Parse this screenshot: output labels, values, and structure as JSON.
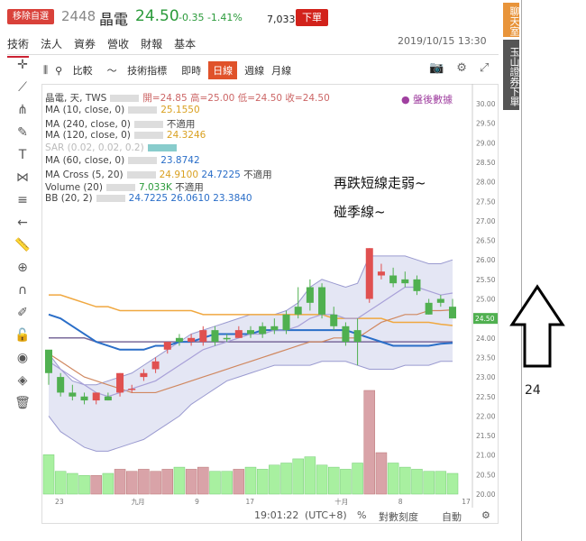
{
  "header": {
    "tag_button": "移除自選",
    "code": "2448",
    "name": "晶電",
    "price": "24.50",
    "change": "-0.35 -1.41%",
    "volume": "7,033.4張",
    "order_button": "下單",
    "datetime": "2019/10/15 13:30"
  },
  "tabs": [
    "技術",
    "法人",
    "資券",
    "營收",
    "財報",
    "基本"
  ],
  "sidebar": {
    "chat": "聊天室",
    "broker": "玉山證券下單"
  },
  "chart_toolbar": {
    "compare": "比較",
    "indicators": "技術指標",
    "realtime": "即時",
    "daily": "日線",
    "weekly": "週線",
    "monthly": "月線"
  },
  "info": {
    "line1": "晶電, 天, TWS",
    "ohlc": "開=24.85 高=25.00 低=24.50 收=24.50",
    "ma10": "MA (10, close, 0)",
    "ma10v": "25.1550",
    "ma240": "MA (240, close, 0)",
    "ma240v": "不適用",
    "ma120": "MA (120, close, 0)",
    "ma120v": "24.3246",
    "sar": "SAR (0.02, 0.02, 0.2)",
    "ma60": "MA (60, close, 0)",
    "ma60v": "23.8742",
    "macross": "MA Cross (5, 20)",
    "macv1": "24.9100",
    "macv2": "24.7225",
    "macv3": "不適用",
    "volume": "Volume (20)",
    "volv1": "7.033K",
    "volv2": "不適用",
    "bb": "BB (20, 2)",
    "bbv1": "24.7225",
    "bbv2": "26.0610",
    "bbv3": "23.3840"
  },
  "watermark": "盤後數據",
  "notes": {
    "line1": "再跌短線走弱~",
    "line2": "碰季線~"
  },
  "bottom": {
    "time": "19:01:22",
    "tz": "(UTC+8)",
    "pct": "%",
    "log": "對數刻度",
    "auto": "自動"
  },
  "arrow_label": "24",
  "chart_data": {
    "type": "candlestick",
    "y_ticks": [
      "30.00",
      "29.50",
      "29.00",
      "28.50",
      "28.00",
      "27.50",
      "27.00",
      "26.50",
      "26.00",
      "25.50",
      "25.00",
      "24.50",
      "24.00",
      "23.50",
      "23.00",
      "22.50",
      "22.00",
      "21.50",
      "21.00",
      "20.50",
      "20.00"
    ],
    "x_ticks": [
      "23",
      "九月",
      "9",
      "17",
      "十月",
      "8",
      "17"
    ],
    "last_price_label": "24.50",
    "candles": [
      {
        "o": 23.1,
        "h": 23.6,
        "l": 22.8,
        "c": 23.7,
        "up": false
      },
      {
        "o": 23.0,
        "h": 23.1,
        "l": 22.5,
        "c": 22.6,
        "up": false
      },
      {
        "o": 22.6,
        "h": 22.8,
        "l": 22.4,
        "c": 22.5,
        "up": false
      },
      {
        "o": 22.5,
        "h": 22.6,
        "l": 22.3,
        "c": 22.4,
        "up": false
      },
      {
        "o": 22.4,
        "h": 22.6,
        "l": 22.3,
        "c": 22.6,
        "up": true
      },
      {
        "o": 22.5,
        "h": 22.6,
        "l": 22.4,
        "c": 22.4,
        "up": false
      },
      {
        "o": 22.6,
        "h": 23.1,
        "l": 22.5,
        "c": 23.1,
        "up": true
      },
      {
        "o": 22.7,
        "h": 22.8,
        "l": 22.6,
        "c": 22.7,
        "up": true
      },
      {
        "o": 23.0,
        "h": 23.2,
        "l": 22.9,
        "c": 23.1,
        "up": true
      },
      {
        "o": 23.2,
        "h": 23.5,
        "l": 23.1,
        "c": 23.4,
        "up": true
      },
      {
        "o": 23.7,
        "h": 23.9,
        "l": 23.6,
        "c": 23.9,
        "up": true
      },
      {
        "o": 23.9,
        "h": 24.1,
        "l": 23.8,
        "c": 24.0,
        "up": false
      },
      {
        "o": 24.0,
        "h": 24.1,
        "l": 23.8,
        "c": 23.9,
        "up": true
      },
      {
        "o": 23.9,
        "h": 24.3,
        "l": 23.8,
        "c": 24.2,
        "up": true
      },
      {
        "o": 24.2,
        "h": 24.3,
        "l": 23.8,
        "c": 23.9,
        "up": false
      },
      {
        "o": 24.0,
        "h": 24.1,
        "l": 23.9,
        "c": 24.0,
        "up": false
      },
      {
        "o": 24.0,
        "h": 24.3,
        "l": 24.0,
        "c": 24.2,
        "up": true
      },
      {
        "o": 24.2,
        "h": 24.3,
        "l": 24.0,
        "c": 24.1,
        "up": false
      },
      {
        "o": 24.1,
        "h": 24.4,
        "l": 24.0,
        "c": 24.3,
        "up": false
      },
      {
        "o": 24.3,
        "h": 24.5,
        "l": 24.1,
        "c": 24.2,
        "up": false
      },
      {
        "o": 24.2,
        "h": 24.7,
        "l": 24.1,
        "c": 24.6,
        "up": false
      },
      {
        "o": 24.6,
        "h": 25.3,
        "l": 24.5,
        "c": 24.8,
        "up": false
      },
      {
        "o": 24.9,
        "h": 25.5,
        "l": 24.7,
        "c": 25.3,
        "up": false
      },
      {
        "o": 25.3,
        "h": 25.4,
        "l": 24.5,
        "c": 24.6,
        "up": false
      },
      {
        "o": 24.6,
        "h": 24.8,
        "l": 24.2,
        "c": 24.3,
        "up": false
      },
      {
        "o": 24.3,
        "h": 24.4,
        "l": 23.8,
        "c": 23.9,
        "up": false
      },
      {
        "o": 23.9,
        "h": 24.5,
        "l": 23.3,
        "c": 24.2,
        "up": false
      },
      {
        "o": 25.0,
        "h": 26.3,
        "l": 24.9,
        "c": 26.3,
        "up": true
      },
      {
        "o": 25.7,
        "h": 25.9,
        "l": 25.5,
        "c": 25.6,
        "up": true
      },
      {
        "o": 25.6,
        "h": 25.8,
        "l": 25.3,
        "c": 25.4,
        "up": false
      },
      {
        "o": 25.5,
        "h": 25.7,
        "l": 25.3,
        "c": 25.4,
        "up": false
      },
      {
        "o": 25.5,
        "h": 25.6,
        "l": 25.1,
        "c": 25.2,
        "up": false
      },
      {
        "o": 24.9,
        "h": 25.0,
        "l": 24.6,
        "c": 24.6,
        "up": false
      },
      {
        "o": 24.9,
        "h": 25.1,
        "l": 24.8,
        "c": 25.0,
        "up": false
      },
      {
        "o": 24.8,
        "h": 25.0,
        "l": 24.5,
        "c": 24.5,
        "up": false
      }
    ],
    "volumes": [
      38,
      22,
      20,
      18,
      18,
      20,
      24,
      22,
      24,
      22,
      24,
      26,
      24,
      26,
      22,
      22,
      24,
      26,
      24,
      28,
      30,
      34,
      36,
      28,
      26,
      24,
      30,
      100,
      40,
      30,
      26,
      24,
      22,
      22,
      20
    ],
    "bb_upper": [
      23.6,
      23.2,
      22.9,
      22.8,
      22.8,
      22.9,
      23.0,
      23.1,
      23.3,
      23.5,
      23.7,
      23.9,
      24.1,
      24.2,
      24.3,
      24.4,
      24.5,
      24.6,
      24.6,
      24.6,
      24.7,
      24.9,
      25.3,
      25.5,
      25.4,
      25.3,
      25.4,
      26.1,
      26.1,
      26.1,
      26.1,
      26.0,
      25.9,
      25.9,
      26.0
    ],
    "bb_lower": [
      22.0,
      21.6,
      21.4,
      21.2,
      21.1,
      21.1,
      21.2,
      21.3,
      21.4,
      21.6,
      21.8,
      22.0,
      22.3,
      22.5,
      22.7,
      22.9,
      23.0,
      23.1,
      23.2,
      23.3,
      23.3,
      23.3,
      23.3,
      23.4,
      23.4,
      23.4,
      23.3,
      23.2,
      23.2,
      23.2,
      23.3,
      23.3,
      23.3,
      23.4,
      23.4
    ],
    "ma10": [
      23.4,
      23.2,
      23.0,
      22.8,
      22.6,
      22.5,
      22.6,
      22.7,
      22.8,
      22.9,
      23.1,
      23.3,
      23.5,
      23.7,
      23.8,
      23.9,
      24.0,
      24.1,
      24.1,
      24.2,
      24.2,
      24.3,
      24.5,
      24.6,
      24.6,
      24.5,
      24.5,
      24.7,
      24.9,
      25.1,
      25.3,
      25.3,
      25.2,
      25.1,
      25.15
    ],
    "ma20": [
      23.6,
      23.4,
      23.2,
      23.0,
      22.9,
      22.8,
      22.7,
      22.6,
      22.6,
      22.6,
      22.7,
      22.8,
      22.9,
      23.0,
      23.1,
      23.2,
      23.3,
      23.4,
      23.5,
      23.6,
      23.7,
      23.8,
      23.9,
      23.9,
      24.0,
      24.0,
      24.0,
      24.2,
      24.4,
      24.5,
      24.6,
      24.6,
      24.7,
      24.7,
      24.72
    ],
    "ma60": [
      24.6,
      24.5,
      24.3,
      24.1,
      23.9,
      23.8,
      23.7,
      23.7,
      23.7,
      23.8,
      23.8,
      23.9,
      23.9,
      24.0,
      24.1,
      24.1,
      24.1,
      24.1,
      24.2,
      24.2,
      24.2,
      24.2,
      24.2,
      24.2,
      24.2,
      24.2,
      24.1,
      24.0,
      23.9,
      23.8,
      23.8,
      23.8,
      23.8,
      23.85,
      23.87
    ],
    "ma120": [
      25.1,
      25.1,
      25.0,
      24.9,
      24.8,
      24.8,
      24.7,
      24.7,
      24.7,
      24.7,
      24.7,
      24.7,
      24.7,
      24.6,
      24.6,
      24.6,
      24.6,
      24.6,
      24.6,
      24.6,
      24.6,
      24.6,
      24.6,
      24.6,
      24.5,
      24.5,
      24.5,
      24.5,
      24.5,
      24.4,
      24.4,
      24.4,
      24.4,
      24.35,
      24.32
    ],
    "ma240": [
      24.0,
      24.0,
      24.0,
      24.0,
      23.9,
      23.9,
      23.9,
      23.9,
      23.9,
      23.9,
      23.9,
      23.9,
      23.9,
      23.9,
      23.9,
      23.9,
      23.9,
      23.9,
      23.9,
      23.9,
      23.9,
      23.9,
      23.9,
      23.9,
      23.9,
      23.9,
      23.9,
      23.9,
      23.9,
      23.9,
      23.9,
      23.9,
      23.9,
      23.9,
      23.9
    ]
  }
}
